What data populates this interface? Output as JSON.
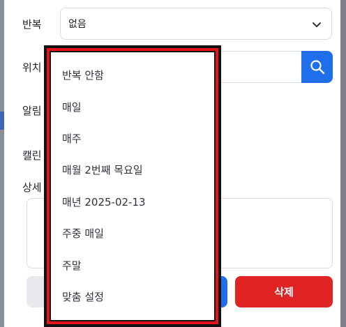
{
  "form": {
    "repeat_label": "반복",
    "repeat_value": "없음",
    "location_label": "위치",
    "location_value": "",
    "alarm_label": "알림",
    "calendar_label": "캘린",
    "detail_label": "상세",
    "memo_value": ""
  },
  "buttons": {
    "cancel_label": "",
    "delete_label": "삭제"
  },
  "repeat_options": [
    "반복 안함",
    "매일",
    "매주",
    "매월 2번째 목요일",
    "매년 2025-02-13",
    "주중 매일",
    "주말",
    "맞춤 설정"
  ],
  "colors": {
    "accent": "#1f6feb",
    "danger": "#e02424",
    "highlight": "#e3141c"
  },
  "icons": [
    "chevron-down-icon",
    "search-icon"
  ]
}
